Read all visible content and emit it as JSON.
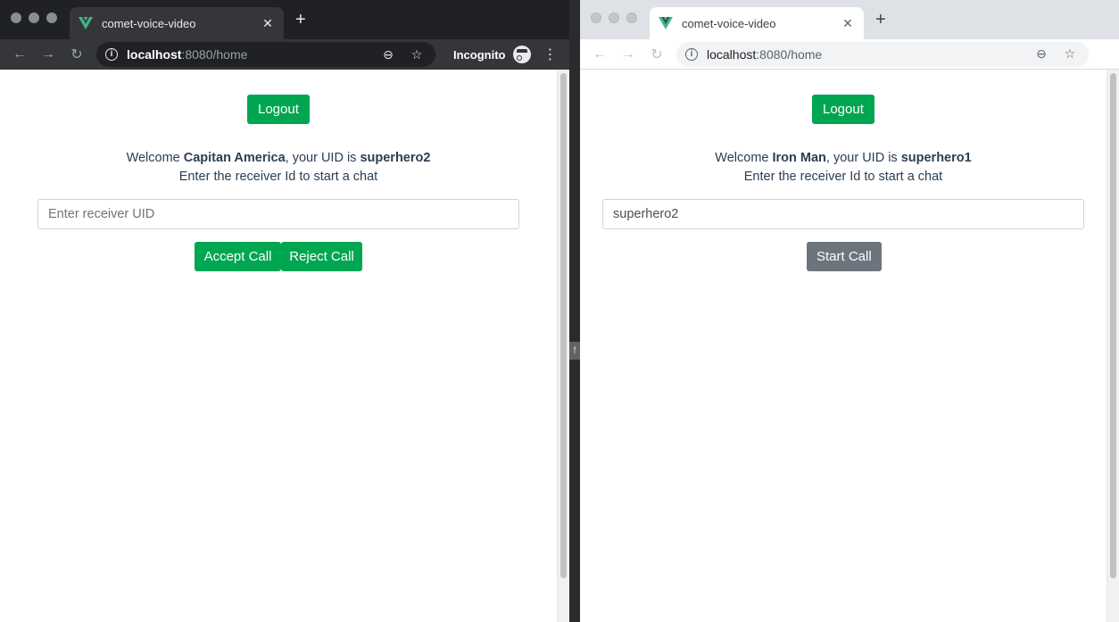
{
  "left": {
    "tab_title": "comet-voice-video",
    "url_host": "localhost",
    "url_path": ":8080/home",
    "incognito_label": "Incognito",
    "logout_label": "Logout",
    "welcome_prefix": "Welcome",
    "user_name": "Capitan America",
    "uid_text": ", your UID is",
    "uid": "superhero2",
    "instruction": "Enter the receiver Id to start a chat",
    "receiver_placeholder": "Enter receiver UID",
    "accept_label": "Accept Call",
    "reject_label": "Reject Call"
  },
  "right": {
    "tab_title": "comet-voice-video",
    "url_host": "localhost",
    "url_path": ":8080/home",
    "logout_label": "Logout",
    "welcome_prefix": "Welcome",
    "user_name": "Iron Man",
    "uid_text": ", your UID is",
    "uid": "superhero1",
    "instruction": "Enter the receiver Id to start a chat",
    "receiver_value": "superhero2",
    "start_label": "Start Call"
  },
  "colors": {
    "accent_green": "#00a651",
    "button_grey": "#6c757d",
    "vue_green": "#41b883",
    "vue_dark": "#35495e"
  },
  "icons": [
    "vue-logo-icon",
    "close-icon",
    "plus-icon",
    "back-icon",
    "forward-icon",
    "reload-icon",
    "info-icon",
    "zoom-icon",
    "star-icon",
    "incognito-icon",
    "menu-icon",
    "avatar"
  ]
}
